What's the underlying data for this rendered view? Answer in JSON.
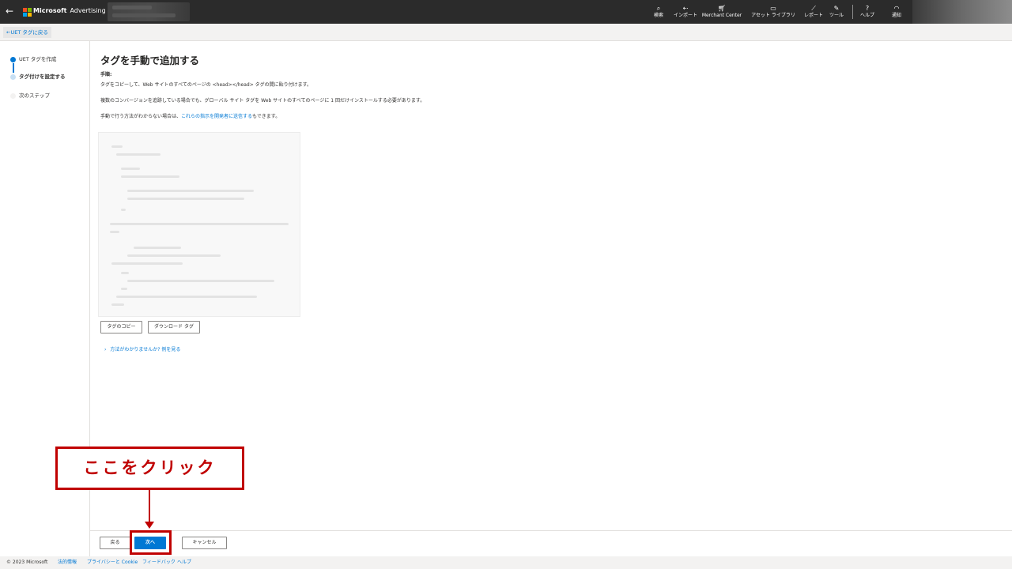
{
  "topbar": {
    "brand_main": "Microsoft",
    "brand_sub": "Advertising",
    "logo_colors": [
      "#f25022",
      "#7fba00",
      "#00a4ef",
      "#ffb900"
    ],
    "nav": [
      {
        "icon": "search-icon",
        "label": "検索"
      },
      {
        "icon": "import-icon",
        "label": "インポート"
      },
      {
        "icon": "cart-icon",
        "label": "Merchant Center"
      },
      {
        "icon": "asset-library-icon",
        "label": "アセット ライブラリ"
      },
      {
        "icon": "reports-icon",
        "label": "レポート"
      },
      {
        "icon": "tools-icon",
        "label": "ツール"
      },
      {
        "icon": "help-icon",
        "label": "ヘルプ"
      },
      {
        "icon": "bell-icon",
        "label": "通知"
      }
    ]
  },
  "back_link": "UET タグに戻る",
  "steps": [
    {
      "label": "UET タグを作成",
      "state": "done"
    },
    {
      "label": "タグ付けを設定する",
      "state": "current"
    },
    {
      "label": "次のステップ",
      "state": "pending"
    }
  ],
  "main": {
    "title": "タグを手動で追加する",
    "steps_heading": "手順:",
    "line1": "タグをコピーして、Web サイトのすべてのページの <head></head> タグの間に貼り付けます。",
    "line2": "複数のコンバージョンを追跡している場合でも、グローバル サイト タグを Web サイトのすべてのページに 1 回だけインストールする必要があります。",
    "line3_before": "手動で行う方法がわからない場合は、",
    "line3_link": "これらの指示を開発者に送信する",
    "line3_after": "もできます。",
    "copy_button": "タグのコピー",
    "download_button": "ダウンロード タグ",
    "expander_label": "方法がわかりませんか? 例を見る"
  },
  "actions": {
    "back": "戻る",
    "next": "次へ",
    "cancel": "キャンセル"
  },
  "footer": {
    "copyright": "© 2023 Microsoft",
    "links": [
      "法的情報",
      "プライバシーと Cookie",
      "フィードバック",
      "ヘルプ"
    ]
  },
  "annotation": {
    "callout_text": "ここをクリック",
    "color": "#c00000"
  }
}
